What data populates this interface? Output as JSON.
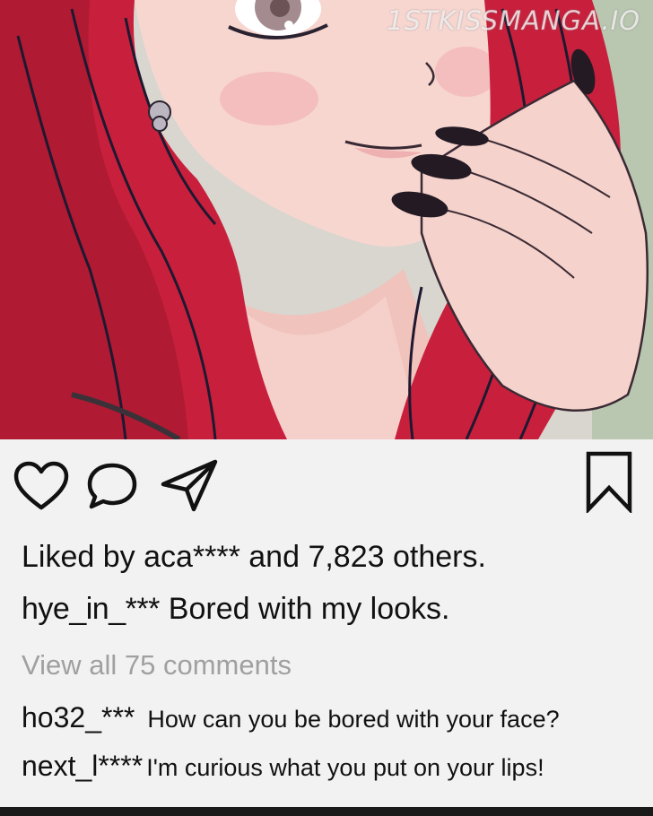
{
  "watermark": "1STKISSMANGA.IO",
  "post": {
    "liked_by": "Liked by aca**** and 7,823 others.",
    "caption": {
      "username": "hye_in_***",
      "text": "Bored with my looks."
    },
    "view_all": "View all 75 comments",
    "comments": [
      {
        "username": "ho32_***",
        "text": "How can you be bored with your face?"
      },
      {
        "username": "next_l****",
        "text": "I'm curious what you put on your lips!"
      }
    ]
  },
  "icons": {
    "like": "heart-icon",
    "comment": "speech-bubble-icon",
    "share": "paper-plane-icon",
    "save": "bookmark-icon"
  },
  "colors": {
    "background": "#f2f2f2",
    "hair": "#c8203c",
    "skin": "#f6d2cc",
    "muted_text": "#a0a0a0"
  }
}
